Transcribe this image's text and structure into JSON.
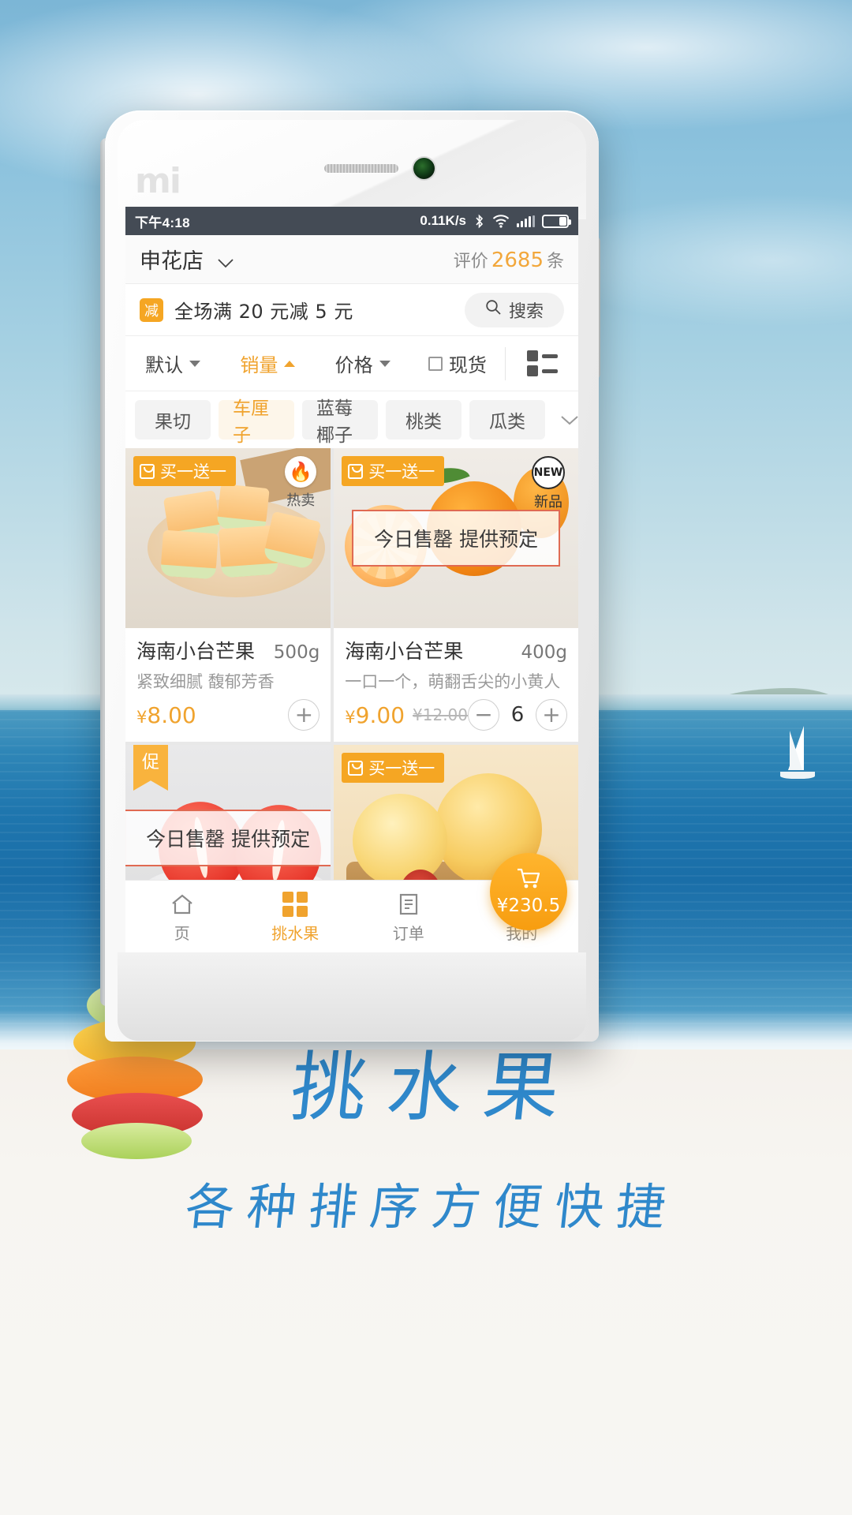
{
  "statusbar": {
    "time": "下午4:18",
    "speed": "0.11K/s",
    "icons": [
      "bluetooth-icon",
      "wifi-icon",
      "signal-icon",
      "battery-icon"
    ]
  },
  "store_header": {
    "name": "申花店",
    "chevron": "⌄",
    "reviews_label": "评价",
    "reviews_count": "2685",
    "reviews_unit": "条"
  },
  "promo": {
    "badge": "减",
    "text": "全场满 20 元减 5 元",
    "search_label": "搜索"
  },
  "sortbar": {
    "items": [
      {
        "label": "默认",
        "arrow": "down",
        "active": false
      },
      {
        "label": "销量",
        "arrow": "up",
        "active": true
      },
      {
        "label": "价格",
        "arrow": "down",
        "active": false
      },
      {
        "label": "现货",
        "arrow": "checkbox",
        "active": false
      }
    ],
    "view_mode_icon": "list-view-icon"
  },
  "categories": {
    "items": [
      "果切",
      "车厘子",
      "蓝莓椰子",
      "桃类",
      "瓜类"
    ],
    "active_index": 1,
    "more_icon": "chevron-down-icon"
  },
  "products": [
    {
      "name": "海南小台芒果",
      "weight": "500g",
      "desc": "紧致细腻 馥郁芳香",
      "price": "8.00",
      "currency": "¥",
      "old_price": "",
      "badge": "买一送一",
      "corner_label": "热卖",
      "corner_icon": "flame-icon",
      "sold_out": "",
      "qty": ""
    },
    {
      "name": "海南小台芒果",
      "weight": "400g",
      "desc": "一口一个，萌翻舌尖的小黄人",
      "price": "9.00",
      "currency": "¥",
      "old_price": "¥12.00",
      "badge": "买一送一",
      "corner_label": "新品",
      "corner_icon": "NEW",
      "sold_out": "今日售罄 提供预定",
      "qty": "6"
    },
    {
      "name": "",
      "weight": "",
      "desc": "",
      "price": "",
      "currency": "",
      "old_price": "",
      "badge": "促",
      "corner_label": "",
      "corner_icon": "",
      "sold_out": "今日售罄 提供预定",
      "qty": ""
    },
    {
      "name": "",
      "weight": "",
      "desc": "",
      "price": "",
      "currency": "",
      "old_price": "",
      "badge": "买一送一",
      "corner_label": "",
      "corner_icon": "",
      "sold_out": "",
      "qty": ""
    }
  ],
  "tabbar": {
    "items": [
      {
        "label": "页",
        "icon": "home-icon",
        "active": false
      },
      {
        "label": "挑水果",
        "icon": "grid-icon",
        "active": true
      },
      {
        "label": "订单",
        "icon": "order-icon",
        "active": false
      },
      {
        "label": "我的",
        "icon": "user-icon",
        "active": false
      }
    ],
    "cart": {
      "icon": "cart-icon",
      "amount": "¥230.5"
    }
  },
  "caption": {
    "main": "挑水果",
    "sub": "各种排序方便快捷"
  },
  "colors": {
    "accent": "#f0a32e",
    "statusbar": "#444b55",
    "caption": "#2f88cb"
  }
}
